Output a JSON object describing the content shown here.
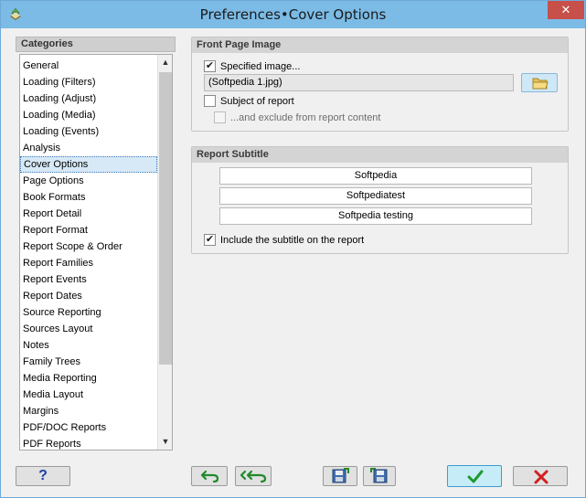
{
  "window": {
    "title": "Preferences•Cover Options",
    "close_glyph": "✕"
  },
  "categories": {
    "header": "Categories",
    "items": [
      "General",
      "Loading (Filters)",
      "Loading (Adjust)",
      "Loading (Media)",
      "Loading (Events)",
      "Analysis",
      "Cover Options",
      "Page Options",
      "Book Formats",
      "Report Detail",
      "Report Format",
      "Report Scope & Order",
      "Report Families",
      "Report Events",
      "Report Dates",
      "Source Reporting",
      "Sources Layout",
      "Notes",
      "Family Trees",
      "Media Reporting",
      "Media Layout",
      "Margins",
      "PDF/DOC Reports",
      "PDF Reports"
    ],
    "selected": "Cover Options",
    "scroll_up_glyph": "▲",
    "scroll_down_glyph": "▼"
  },
  "front_page": {
    "title": "Front Page Image",
    "specified_image_label": "Specified image...",
    "specified_image_checked": true,
    "file_value": "(Softpedia 1.jpg)",
    "browse_icon": "folder-icon",
    "subject_label": "Subject of report",
    "subject_checked": false,
    "exclude_label": "...and exclude from report content",
    "exclude_checked": false,
    "exclude_enabled": false
  },
  "report_subtitle": {
    "title": "Report Subtitle",
    "lines": [
      "Softpedia",
      "Softpediatest",
      "Softpedia testing"
    ],
    "include_label": "Include the subtitle on the report",
    "include_checked": true
  },
  "buttons": {
    "help_label": "?",
    "undo_icon": "undo-arrow-icon",
    "undo_all_icon": "undo-all-arrows-icon",
    "save_icon": "save-disk-icon",
    "load_icon": "load-disk-icon",
    "ok_icon": "green-check-icon",
    "cancel_icon": "red-x-icon"
  },
  "colors": {
    "titlebar": "#7bbbe6",
    "ok_green": "#1f9a2f",
    "cancel_red": "#d11f1f",
    "selection": "#d7e9f7"
  },
  "check_glyph": "✔"
}
